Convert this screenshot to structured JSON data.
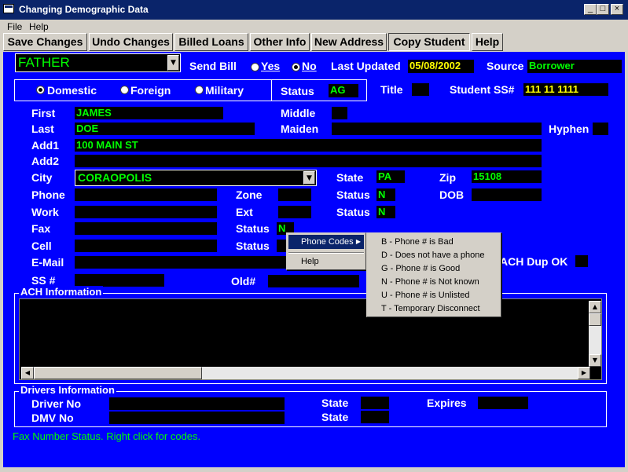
{
  "window": {
    "title": "Changing Demographic Data",
    "min": "_",
    "max": "□",
    "close": "×"
  },
  "menubar": {
    "file": "File",
    "help": "Help"
  },
  "toolbar": {
    "save": "Save Changes",
    "undo": "Undo Changes",
    "billed": "Billed Loans",
    "other": "Other Info",
    "newaddr": "New Address",
    "copy": "Copy Student",
    "help": "Help"
  },
  "header": {
    "relation": "FATHER",
    "send_bill_label": "Send Bill",
    "yes": "Yes",
    "no": "No",
    "last_updated_label": "Last Updated",
    "last_updated": "05/08/2002",
    "source_label": "Source",
    "source": "Borrower"
  },
  "address_type": {
    "domestic": "Domestic",
    "foreign": "Foreign",
    "military": "Military",
    "status_label": "Status",
    "status": "AG"
  },
  "title_label": "Title",
  "title_value": "",
  "student_ss_label": "Student SS#",
  "student_ss": "111 11 1111",
  "person": {
    "first_label": "First",
    "first": "JAMES",
    "middle_label": "Middle",
    "middle": "",
    "last_label": "Last",
    "last": "DOE",
    "maiden_label": "Maiden",
    "maiden": "",
    "hyphen_label": "Hyphen",
    "hyphen": "",
    "add1_label": "Add1",
    "add1": "100 MAIN ST",
    "add2_label": "Add2",
    "add2": "",
    "city_label": "City",
    "city": "CORAOPOLIS",
    "state_label": "State",
    "state": "PA",
    "zip_label": "Zip",
    "zip": "15108",
    "phone_label": "Phone",
    "phone": "",
    "zone_label": "Zone",
    "zone": "",
    "status_label": "Status",
    "phone_status": "N",
    "dob_label": "DOB",
    "dob": "",
    "work_label": "Work",
    "work": "",
    "ext_label": "Ext",
    "ext": "",
    "work_status": "N",
    "fax_label": "Fax",
    "fax": "",
    "fax_status": "N",
    "cell_label": "Cell",
    "cell": "",
    "cell_status": "",
    "email_label": "E-Mail",
    "email": "",
    "ach_dup_label": "ACH Dup OK",
    "ss_label": "SS #",
    "ss": "",
    "old_label": "Old#",
    "old": ""
  },
  "ach": {
    "title": "ACH Information"
  },
  "drivers": {
    "title": "Drivers Information",
    "driver_no_label": "Driver No",
    "state_label": "State",
    "expires_label": "Expires",
    "dmv_no_label": "DMV No"
  },
  "status_message": "Fax Number Status. Right click for codes.",
  "context_menu": {
    "phone_codes": "Phone Codes",
    "help": "Help"
  },
  "phone_codes": [
    "B - Phone # is Bad",
    "D - Does not have a phone",
    "G - Phone # is Good",
    "N - Phone # is Not known",
    "U - Phone # is Unlisted",
    "T - Temporary Disconnect"
  ]
}
